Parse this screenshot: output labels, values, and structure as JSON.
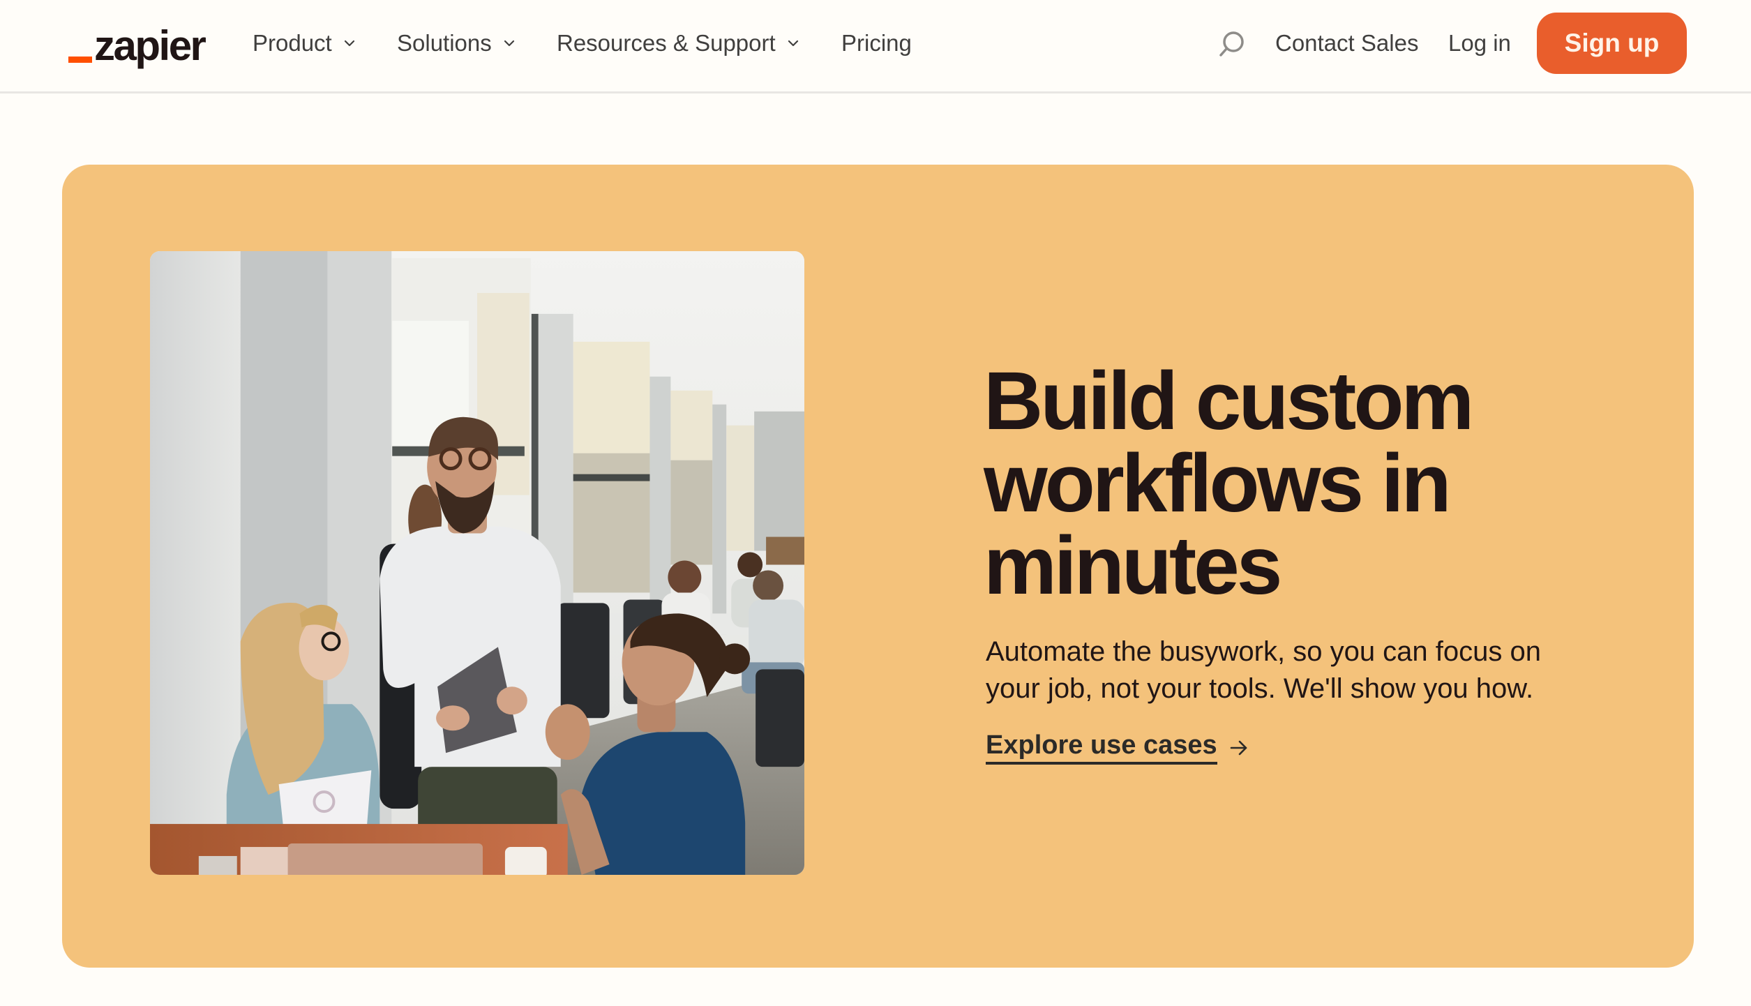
{
  "brand": {
    "name": "zapier",
    "accent_color": "#FF4F00"
  },
  "nav": {
    "items": [
      {
        "label": "Product",
        "has_dropdown": true
      },
      {
        "label": "Solutions",
        "has_dropdown": true
      },
      {
        "label": "Resources & Support",
        "has_dropdown": true
      },
      {
        "label": "Pricing",
        "has_dropdown": false
      }
    ],
    "search_icon": "search-icon",
    "contact_sales": "Contact Sales",
    "login": "Log in",
    "signup": "Sign up",
    "signup_color": "#E95E2C"
  },
  "hero": {
    "background_color": "#F4C27B",
    "title_lines": [
      "Build custom",
      "workflows in",
      "minutes"
    ],
    "subtitle": "Automate the busywork, so you can focus on your job, not your tools. We'll show you how.",
    "cta_label": "Explore use cases",
    "cta_icon": "arrow-right-icon",
    "image_alt": "Three colleagues talking in a bright open-plan office, one standing holding a folder"
  }
}
